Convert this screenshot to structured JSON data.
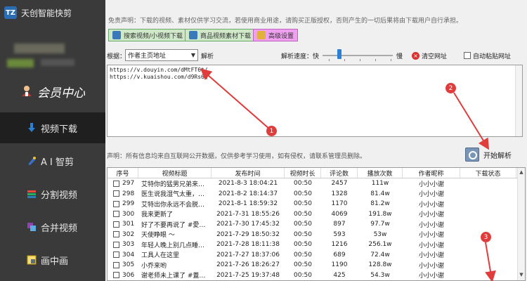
{
  "app": {
    "logo_text": "TZ",
    "title": "天创智能快剪"
  },
  "sidebar": {
    "member_label": "会员中心",
    "items": [
      {
        "label": "视频下载",
        "icon": "download-arrow-icon"
      },
      {
        "label": "A I 智剪",
        "icon": "ai-edit-icon"
      },
      {
        "label": "分割视频",
        "icon": "split-icon"
      },
      {
        "label": "合并视频",
        "icon": "merge-icon"
      },
      {
        "label": "画中画",
        "icon": "pip-icon"
      }
    ]
  },
  "main": {
    "disclaimer": "免责声明：下载的视频、素材仅供学习交流，若使用商业用途，请购买正版授权，否则产生的一切后果将由下载用户自行承担。",
    "buttons": {
      "b1": "搜索视频/小视频下载",
      "b2": "商品视频素材下载",
      "b3": "高级设置"
    },
    "parse_row": {
      "by_label": "根据：",
      "select_value": "作者主页地址",
      "parse_label": "解析",
      "speed_label": "解析速度：快",
      "slow_label": "慢",
      "clear_label": "清空网址",
      "auto_label": "自动粘贴网址"
    },
    "urls": [
      "https://v.douyin.com/dMtFT6t/",
      "https://v.kuaishou.com/d9Rs6Q"
    ],
    "notice": "声明：所有信息均来自互联网公开数据，仅供参考学习使用，如有侵权，请联系管理员删除。",
    "start_parse": "开始解析"
  },
  "table": {
    "headers": [
      "序号",
      "视频标题",
      "发布时间",
      "视频时长",
      "评论数",
      "播放次数",
      "作者昵称",
      "下载状态"
    ],
    "rows": [
      [
        "297",
        "艾特你的猛男兄弟来…",
        "2021-8-3 18:04:21",
        "00:50",
        "2457",
        "111w",
        "小小小谢",
        ""
      ],
      [
        "298",
        "医生说我湿气太重，…",
        "2021-8-2 18:14:37",
        "00:50",
        "1328",
        "81.4w",
        "小小小谢",
        ""
      ],
      [
        "299",
        "艾特出你永远不会脱…",
        "2021-8-1 18:59:32",
        "00:50",
        "1170",
        "81.2w",
        "小小小谢",
        ""
      ],
      [
        "300",
        "我来更新了",
        "2021-7-31 18:55:26",
        "00:50",
        "4069",
        "191.8w",
        "小小小谢",
        ""
      ],
      [
        "301",
        "好了不要再说了 #愛…",
        "2021-7-30 17:45:32",
        "00:50",
        "897",
        "97.7w",
        "小小小谢",
        ""
      ],
      [
        "302",
        "天使睁眼 ～",
        "2021-7-29 18:50:32",
        "00:50",
        "593",
        "53w",
        "小小小谢",
        ""
      ],
      [
        "303",
        "年轻人晚上别几点睡…",
        "2021-7-28 18:11:38",
        "00:50",
        "1216",
        "256.1w",
        "小小小谢",
        ""
      ],
      [
        "304",
        "工具人在这里",
        "2021-7-27 18:37:06",
        "00:50",
        "689",
        "72.4w",
        "小小小谢",
        ""
      ],
      [
        "305",
        "小乔来哟",
        "2021-7-26 18:26:27",
        "00:50",
        "1190",
        "128.8w",
        "小小小谢",
        ""
      ],
      [
        "306",
        "谢老师未上课了 #蓋…",
        "2021-7-25 19:37:48",
        "00:50",
        "425",
        "54.3w",
        "小小小谢",
        ""
      ]
    ]
  },
  "annotations": {
    "m1": "1",
    "m2": "2",
    "m3": "3"
  },
  "colors": {
    "accent_red": "#e03c3c",
    "sidebar_bg": "#3a3a3a",
    "active_nav": "#1f1f1f"
  }
}
